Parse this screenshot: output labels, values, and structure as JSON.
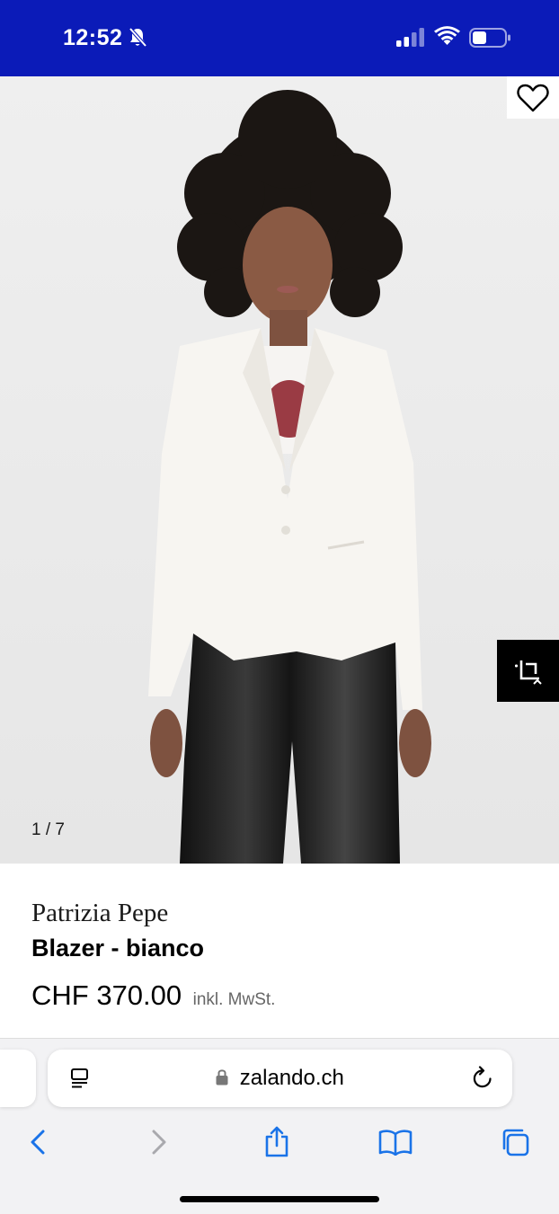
{
  "status_bar": {
    "time": "12:52",
    "icons": [
      "bell-slash-icon",
      "cellular-signal-icon",
      "wifi-icon",
      "battery-icon"
    ],
    "background_color": "#0b1bb8"
  },
  "product": {
    "image_counter": "1 / 7",
    "brand": "Patrizia Pepe",
    "name": "Blazer - bianco",
    "price": "CHF 370.00",
    "vat_note": "inkl. MwSt.",
    "image_actions": [
      "heart-icon",
      "crop-icon"
    ]
  },
  "browser": {
    "url": "zalando.ch",
    "address_icons": [
      "reader-icon",
      "lock-icon",
      "reload-icon"
    ],
    "toolbar_icons": [
      "back-icon",
      "forward-icon",
      "share-icon",
      "bookmarks-icon",
      "tabs-icon"
    ],
    "accent_color": "#1a73e8"
  }
}
